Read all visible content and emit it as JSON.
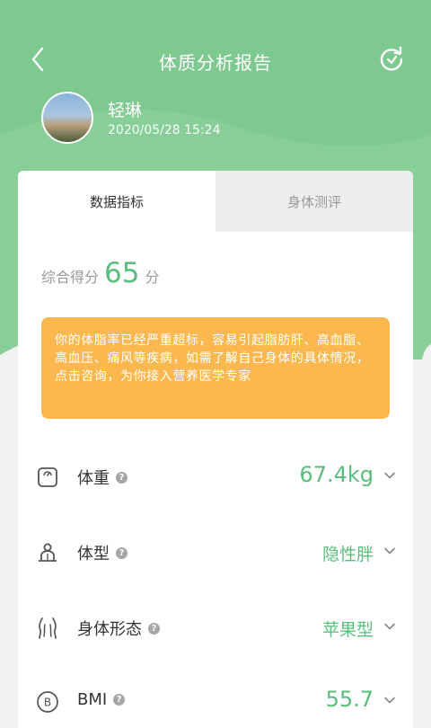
{
  "header": {
    "title": "体质分析报告",
    "back_icon": "chevron-left-icon",
    "refresh_icon": "refresh-icon"
  },
  "user": {
    "name": "轻琳",
    "datetime": "2020/05/28   15:24"
  },
  "tabs": [
    {
      "label": "数据指标",
      "active": true
    },
    {
      "label": "身体测评",
      "active": false
    }
  ],
  "score": {
    "label": "综合得分",
    "value": "65",
    "unit": "分"
  },
  "alert": {
    "text": "你的体脂率已经严重超标，容易引起脂肪肝、高血脂、高血压、痛风等疾病，如需了解自己身体的具体情况，点击咨询，为你接入营养医学专家"
  },
  "metrics": [
    {
      "label": "体重",
      "value": "67.4kg",
      "icon": "scale-icon"
    },
    {
      "label": "体型",
      "value": "隐性胖",
      "icon": "body-type-icon"
    },
    {
      "label": "身体形态",
      "value": "苹果型",
      "icon": "body-shape-icon"
    },
    {
      "label": "BMI",
      "value": "55.7",
      "icon": "bmi-icon"
    }
  ],
  "colors": {
    "header_green": "#7dc98f",
    "accent_green": "#5bbd7b",
    "alert_orange": "#fbb84e"
  }
}
